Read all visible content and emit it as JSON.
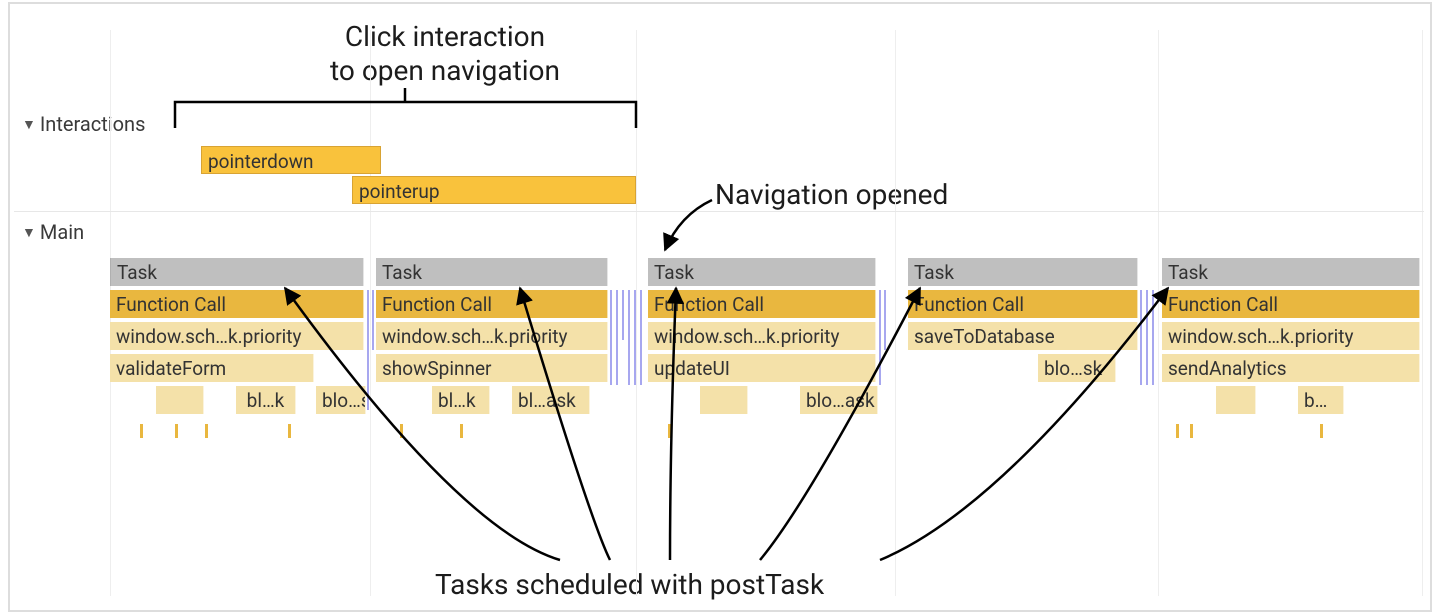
{
  "annotations": {
    "click_line1": "Click interaction",
    "click_line2": "to open navigation",
    "nav_opened": "Navigation opened",
    "tasks_scheduled": "Tasks scheduled with postTask"
  },
  "tracks": {
    "interactions_label": "Interactions",
    "main_label": "Main"
  },
  "interactions": [
    {
      "label": "pointerdown"
    },
    {
      "label": "pointerup"
    }
  ],
  "main": {
    "columns": [
      {
        "task": "Task",
        "fn": "Function Call",
        "sub1": "window.sch…k.priority",
        "sub2": "validateForm",
        "sub3a": "bl…k",
        "sub3b": "blo…sk"
      },
      {
        "task": "Task",
        "fn": "Function Call",
        "sub1": "window.sch…k.priority",
        "sub2": "showSpinner",
        "sub3a": "bl…k",
        "sub3b": "bl…ask"
      },
      {
        "task": "Task",
        "fn": "Function Call",
        "sub1": "window.sch…k.priority",
        "sub2": "updateUI",
        "sub3b": "blo…ask"
      },
      {
        "task": "Task",
        "fn": "Function Call",
        "sub1": "saveToDatabase",
        "sub2": "blo…sk"
      },
      {
        "task": "Task",
        "fn": "Function Call",
        "sub1": "window.sch…k.priority",
        "sub2": "sendAnalytics",
        "sub3b": "b…"
      }
    ]
  }
}
